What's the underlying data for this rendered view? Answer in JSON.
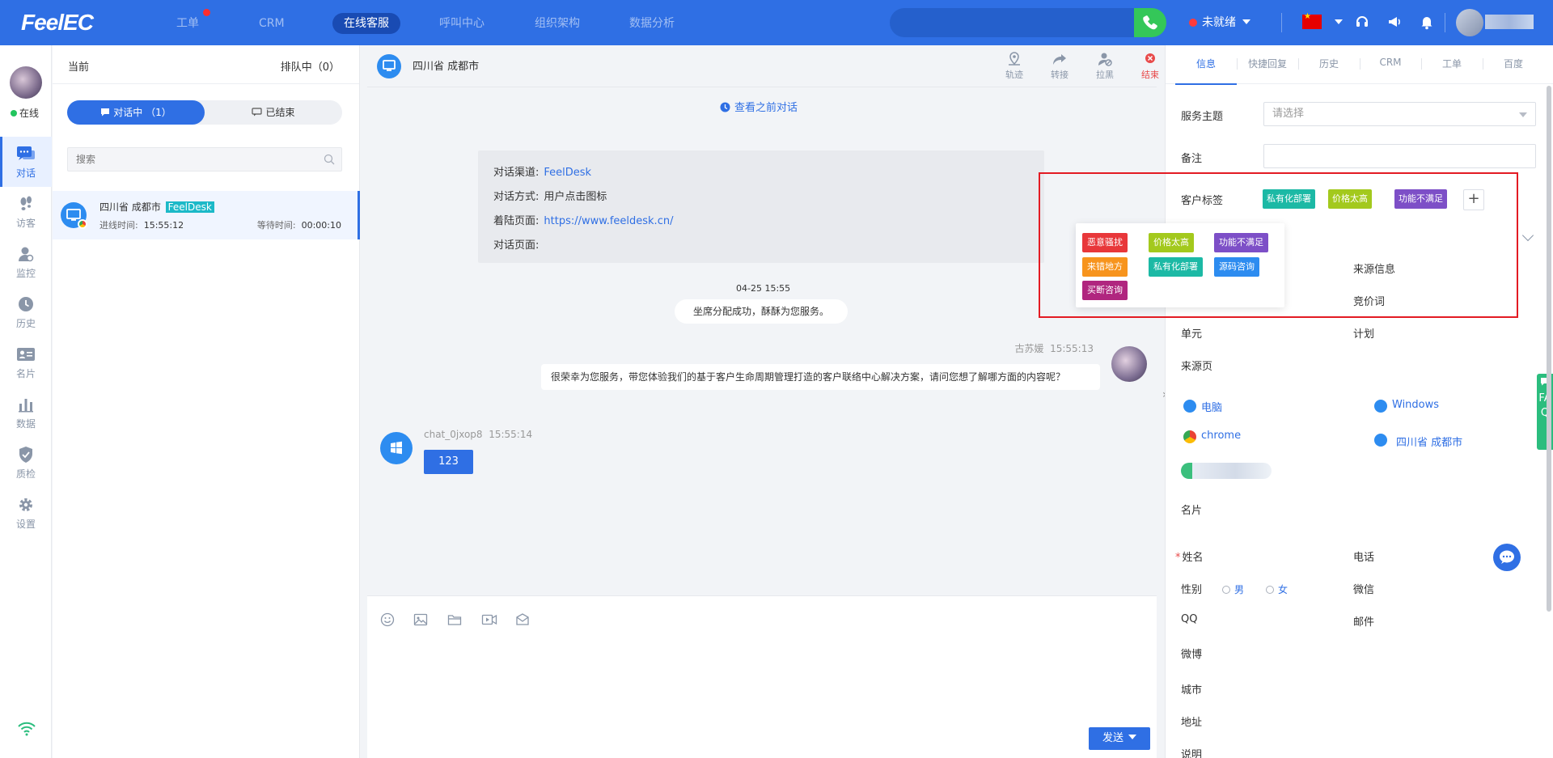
{
  "app": {
    "logo": "FeelEC"
  },
  "topnav": {
    "items": [
      {
        "label": "工单",
        "active": false,
        "dot": true
      },
      {
        "label": "CRM",
        "active": false
      },
      {
        "label": "在线客服",
        "active": true
      },
      {
        "label": "呼叫中心",
        "active": false
      },
      {
        "label": "组织架构",
        "active": false
      },
      {
        "label": "数据分析",
        "active": false
      }
    ],
    "status": "未就绪"
  },
  "sidebar": {
    "status": "在线",
    "items": [
      {
        "label": "对话",
        "icon": "chat-icon",
        "active": true
      },
      {
        "label": "访客",
        "icon": "footprint-icon"
      },
      {
        "label": "监控",
        "icon": "monitor-icon"
      },
      {
        "label": "历史",
        "icon": "history-icon"
      },
      {
        "label": "名片",
        "icon": "card-icon"
      },
      {
        "label": "数据",
        "icon": "data-icon"
      },
      {
        "label": "质检",
        "icon": "shield-icon"
      },
      {
        "label": "设置",
        "icon": "gear-icon"
      }
    ]
  },
  "sessions": {
    "current_label": "当前",
    "queue_label": "排队中（0）",
    "tab_active": "对话中 （1）",
    "tab_ended": "已结束",
    "search_placeholder": "搜索",
    "item": {
      "name": "四川省 成都市",
      "tag": "FeelDesk",
      "in_label": "进线时间:",
      "in_time": "15:55:12",
      "wait_label": "等待时间:",
      "wait_time": "00:00:10"
    }
  },
  "chat": {
    "title": "四川省 成都市",
    "actions": [
      {
        "label": "轨迹",
        "icon": "location-icon"
      },
      {
        "label": "转接",
        "icon": "forward-icon"
      },
      {
        "label": "拉黑",
        "icon": "block-user-icon"
      },
      {
        "label": "结束",
        "icon": "close-icon"
      }
    ],
    "prev_link": "查看之前对话",
    "info": {
      "channel_label": "对话渠道:",
      "channel_value": "FeelDesk",
      "method_label": "对话方式:",
      "method_value": "用户点击图标",
      "landing_label": "着陆页面:",
      "landing_value": "https://www.feeldesk.cn/",
      "page_label": "对话页面:"
    },
    "time_marker": "04-25 15:55",
    "system_msg": "坐席分配成功，酥酥为您服务。",
    "agent_name": "古苏媛",
    "agent_time": "15:55:13",
    "agent_msg": "很荣幸为您服务，带您体验我们的基于客户生命周期管理打造的客户联络中心解决方案，请问您想了解哪方面的内容呢？",
    "cust_name": "chat_0jxop8",
    "cust_time": "15:55:14",
    "cust_msg": "123",
    "send_label": "发送"
  },
  "right": {
    "tabs": [
      "信息",
      "快捷回复",
      "历史",
      "CRM",
      "工单",
      "百度"
    ],
    "subject_label": "服务主题",
    "subject_placeholder": "请选择",
    "note_label": "备注",
    "tags_label": "客户标签",
    "selected_tags": [
      {
        "text": "私有化部署",
        "color": "#1cb9a5"
      },
      {
        "text": "价格太高",
        "color": "#a3c91d"
      },
      {
        "text": "功能不满足",
        "color": "#7d4fc7"
      }
    ],
    "tag_options": [
      {
        "text": "恶意骚扰",
        "color": "#e8373a"
      },
      {
        "text": "价格太高",
        "color": "#a3c91d"
      },
      {
        "text": "功能不满足",
        "color": "#7d4fc7"
      },
      {
        "text": "来错地方",
        "color": "#f7941d"
      },
      {
        "text": "私有化部署",
        "color": "#1cb9a5"
      },
      {
        "text": "源码咨询",
        "color": "#2d8cf0"
      },
      {
        "text": "买断咨询",
        "color": "#b0267f"
      }
    ],
    "source_info_label": "来源信息",
    "keyword_label": "竞价词",
    "unit_label": "单元",
    "plan_label": "计划",
    "source_page_label": "来源页",
    "device": "电脑",
    "os": "Windows",
    "browser": "chrome",
    "location": "四川省 成都市",
    "card_label": "名片",
    "name_label": "姓名",
    "phone_label": "电话",
    "gender_label": "性别",
    "male": "男",
    "female": "女",
    "wechat_label": "微信",
    "qq_label": "QQ",
    "email_label": "邮件",
    "weibo_label": "微博",
    "city_label": "城市",
    "address_label": "地址",
    "desc_label": "说明",
    "faq": "FAQ"
  }
}
